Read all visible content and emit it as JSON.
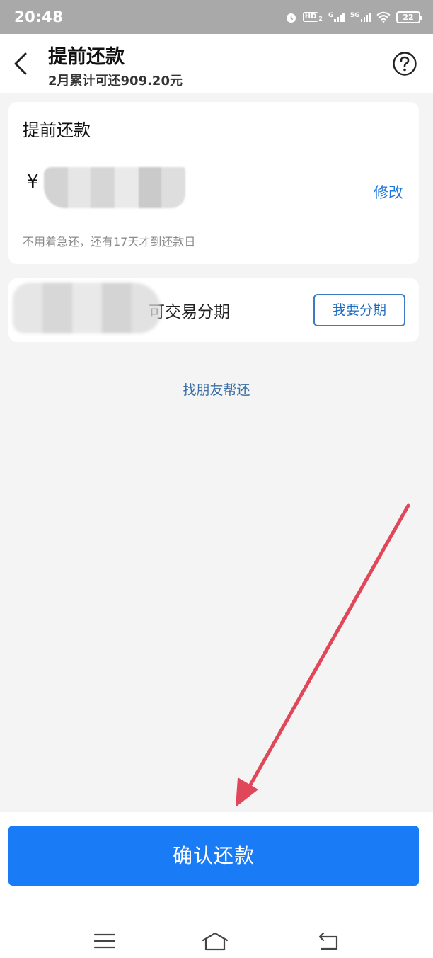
{
  "status_bar": {
    "time": "20:48",
    "hd_label": "HD",
    "hd_sub": "2",
    "net_g": "G",
    "net_5g": "5G",
    "battery": "22",
    "icons": [
      "alarm-icon",
      "hd-icon",
      "signal-icon",
      "signal-5g-icon",
      "wifi-icon",
      "battery-icon"
    ]
  },
  "header": {
    "title": "提前还款",
    "subtitle": "2月累计可还909.20元",
    "back_icon": "chevron-left-icon",
    "help_icon": "question-circle-icon"
  },
  "repay_card": {
    "title": "提前还款",
    "currency": "¥",
    "modify_label": "修改",
    "hint": "不用着急还，还有17天才到还款日"
  },
  "installment_card": {
    "text": "可交易分期",
    "button_label": "我要分期"
  },
  "friend_link": "找朋友帮还",
  "confirm_button": "确认还款",
  "nav_bar": {
    "icons": [
      "menu-icon",
      "home-icon",
      "back-icon"
    ]
  },
  "colors": {
    "primary": "#1a7bf6",
    "link": "#1f7ae0",
    "annotation_arrow": "#e0485a",
    "background": "#f4f4f4"
  }
}
